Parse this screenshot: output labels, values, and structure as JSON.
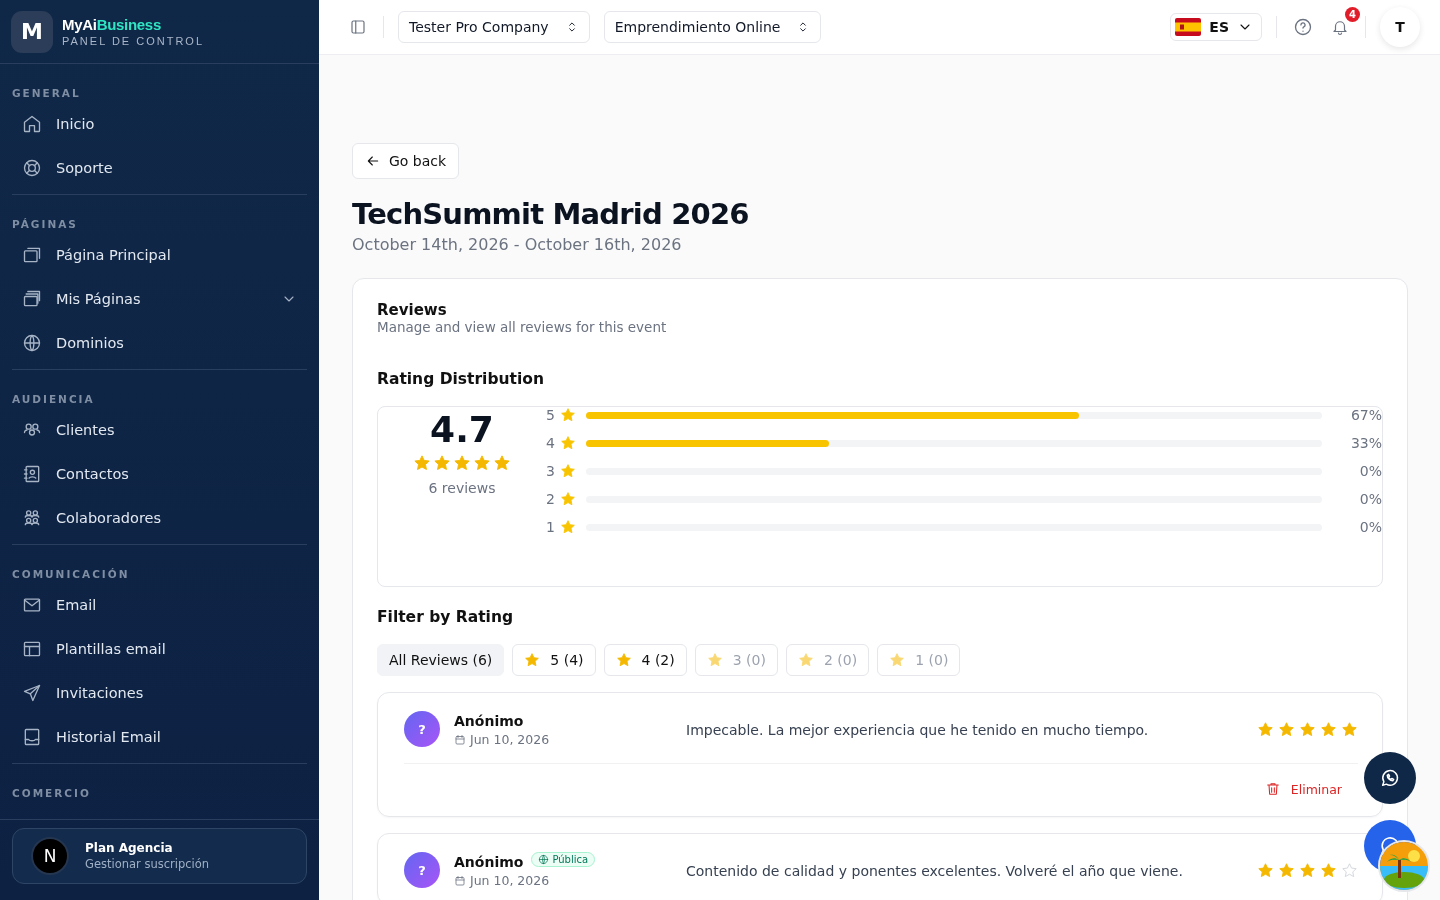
{
  "brand": {
    "name_part1": "MyAi",
    "name_part2": "Business",
    "subtitle": "PANEL DE CONTROL",
    "logo_letter": "M"
  },
  "sidebar": {
    "sections": [
      {
        "label": "GENERAL",
        "items": [
          {
            "label": "Inicio",
            "kind": "link"
          },
          {
            "label": "Soporte",
            "kind": "link"
          }
        ]
      },
      {
        "label": "PÁGINAS",
        "items": [
          {
            "label": "Página Principal",
            "kind": "link"
          },
          {
            "label": "Mis Páginas",
            "kind": "submenu"
          },
          {
            "label": "Dominios",
            "kind": "link"
          }
        ]
      },
      {
        "label": "AUDIENCIA",
        "items": [
          {
            "label": "Clientes",
            "kind": "link"
          },
          {
            "label": "Contactos",
            "kind": "link"
          },
          {
            "label": "Colaboradores",
            "kind": "link"
          }
        ]
      },
      {
        "label": "COMUNICACIÓN",
        "items": [
          {
            "label": "Email",
            "kind": "link"
          },
          {
            "label": "Plantillas email",
            "kind": "link"
          },
          {
            "label": "Invitaciones",
            "kind": "link"
          },
          {
            "label": "Historial Email",
            "kind": "link"
          }
        ]
      },
      {
        "label": "COMERCIO"
      }
    ],
    "plan": {
      "avatar_letter": "N",
      "title": "Plan Agencia",
      "subtitle": "Gestionar suscripción"
    }
  },
  "topbar": {
    "company": "Tester Pro Company",
    "project": "Emprendimiento Online",
    "language": "ES",
    "notification_count": "4",
    "user_initial": "T"
  },
  "back_button": "Go back",
  "event": {
    "title": "TechSummit Madrid 2026",
    "dates": "October 14th, 2026 - October 16th, 2026"
  },
  "reviews": {
    "title": "Reviews",
    "subtitle": "Manage and view all reviews for this event",
    "distribution_title": "Rating Distribution",
    "average": "4.7",
    "stars": 5,
    "count_label": "6 reviews",
    "distribution": [
      {
        "rating": "5",
        "level": 0.67,
        "percent": "67%"
      },
      {
        "rating": "4",
        "level": 0.33,
        "percent": "33%"
      },
      {
        "rating": "3",
        "level": 0,
        "percent": "0%"
      },
      {
        "rating": "2",
        "level": 0,
        "percent": "0%"
      },
      {
        "rating": "1",
        "level": 0,
        "percent": "0%"
      }
    ],
    "filter_title": "Filter by Rating",
    "filters": [
      {
        "label": "All Reviews (6)",
        "kind": "all",
        "selected": true,
        "disabled": false
      },
      {
        "label": "5 (4)",
        "kind": "star",
        "selected": false,
        "disabled": false
      },
      {
        "label": "4 (2)",
        "kind": "star",
        "selected": false,
        "disabled": false
      },
      {
        "label": "3 (0)",
        "kind": "star",
        "selected": false,
        "disabled": true
      },
      {
        "label": "2 (0)",
        "kind": "star",
        "selected": false,
        "disabled": true
      },
      {
        "label": "1 (0)",
        "kind": "star",
        "selected": false,
        "disabled": true
      }
    ],
    "items": [
      {
        "author": "Anónimo",
        "avatar": "?",
        "date": "Jun 10, 2026",
        "text": "Impecable. La mejor experiencia que he tenido en mucho tiempo.",
        "stars": 5,
        "delete_label": "Eliminar"
      },
      {
        "author": "Anónimo",
        "avatar": "?",
        "public_badge": "Pública",
        "date": "Jun 10, 2026",
        "text": "Contenido de calidad y ponentes excelentes. Volveré el año que viene.",
        "stars": 4
      }
    ]
  }
}
